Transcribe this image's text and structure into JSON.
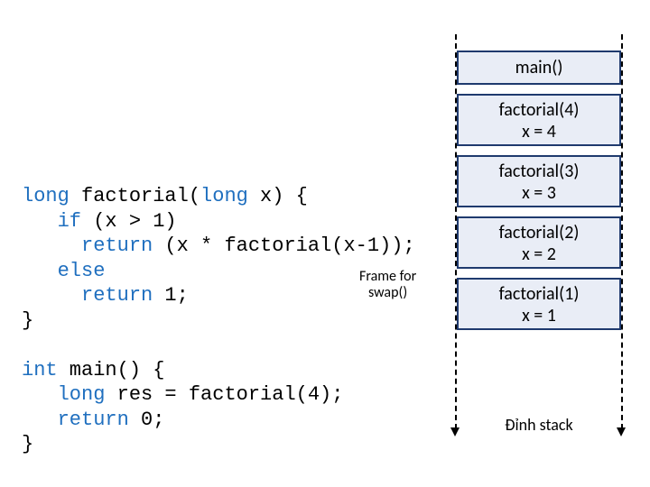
{
  "code": {
    "kw_long": "long",
    "kw_if": "if",
    "kw_return": "return",
    "kw_else": "else",
    "kw_int": "int",
    "fn_sig_rest": " factorial(",
    "param_type": "long",
    "param_rest": " x) {",
    "if_cond": " (x > 1)",
    "ret1_rest": " (x * factorial(x-1));",
    "ret2_rest": " 1;",
    "close": "}",
    "main_sig_rest": " main() {",
    "main_l1": " res = factorial(4);",
    "main_r0": " 0;"
  },
  "annot": {
    "l1": "Frame for",
    "l2": "swap()"
  },
  "frames": [
    {
      "l1": "main()",
      "l2": ""
    },
    {
      "l1": "factorial(4)",
      "l2": "x = 4"
    },
    {
      "l1": "factorial(3)",
      "l2": "x = 3"
    },
    {
      "l1": "factorial(2)",
      "l2": "x = 2"
    },
    {
      "l1": "factorial(1)",
      "l2": "x = 1"
    }
  ],
  "stack_label": "Đỉnh stack"
}
